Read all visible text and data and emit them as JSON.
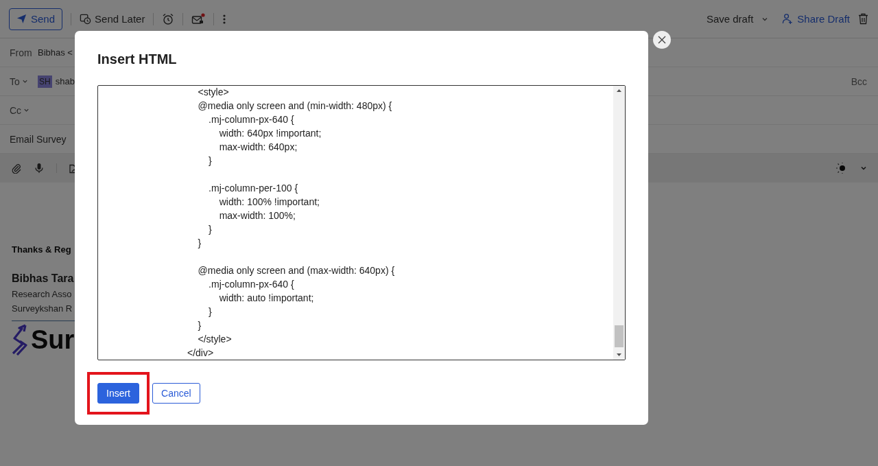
{
  "toolbar": {
    "send": "Send",
    "send_later": "Send Later",
    "save_draft": "Save draft",
    "share_draft": "Share Draft"
  },
  "header_fields": [
    {
      "kind": "from",
      "label": "From",
      "value": "Bibhas <"
    },
    {
      "kind": "to",
      "label": "To",
      "avatar": "SH",
      "value": "shab",
      "extra": "Bcc"
    },
    {
      "kind": "cc",
      "label": "Cc"
    },
    {
      "kind": "subject",
      "value": "Email Survey"
    }
  ],
  "signature": {
    "greeting": "Thanks & Reg",
    "name": "Bibhas Tara",
    "title": "Research Asso",
    "company": "Surveykshan R",
    "logo_text": "Sur"
  },
  "dialog": {
    "title": "Insert HTML",
    "code": "    <style>\n    @media only screen and (min-width: 480px) {\n        .mj-column-px-640 {\n            width: 640px !important;\n            max-width: 640px;\n        }\n\n        .mj-column-per-100 {\n            width: 100% !important;\n            max-width: 100%;\n        }\n    }\n\n    @media only screen and (max-width: 640px) {\n        .mj-column-px-640 {\n            width: auto !important;\n        }\n    }\n    </style>\n</div>",
    "buttons": [
      {
        "label": "Insert",
        "kind": "primary",
        "highlighted": true
      },
      {
        "label": "Cancel",
        "kind": "secondary",
        "highlighted": false
      }
    ]
  }
}
